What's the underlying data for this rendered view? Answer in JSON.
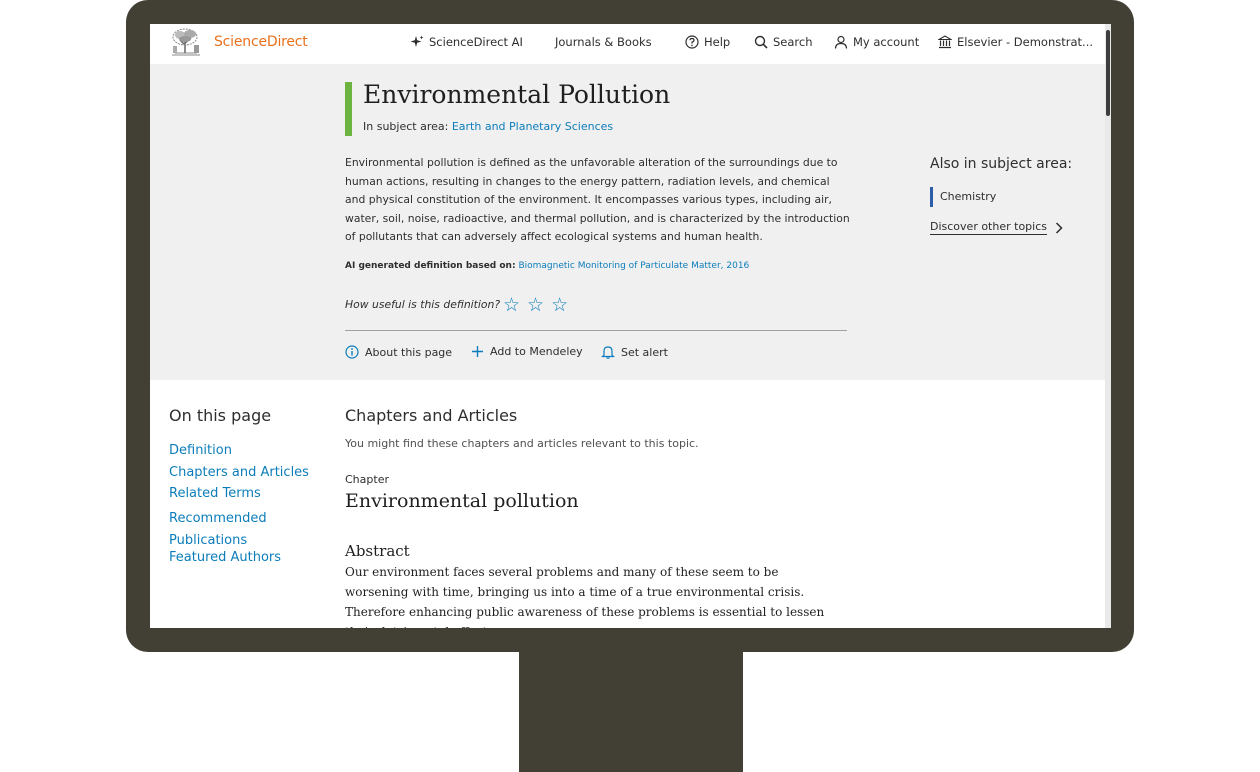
{
  "header": {
    "logo_text": "ScienceDirect",
    "nav": [
      {
        "label": "ScienceDirect AI",
        "icon": "sparkle-icon"
      },
      {
        "label": "Journals & Books",
        "icon": ""
      },
      {
        "label": "Help",
        "icon": "help-circle-icon"
      },
      {
        "label": "Search",
        "icon": "search-icon"
      },
      {
        "label": "My account",
        "icon": "user-icon"
      },
      {
        "label": "Elsevier - Demonstrat...",
        "icon": "institution-icon"
      }
    ]
  },
  "topic": {
    "title": "Environmental Pollution",
    "subject_prefix": "In subject area:",
    "subject_link": "Earth and Planetary Sciences",
    "definition": "Environmental pollution is defined as the unfavorable alteration of the surroundings due to human actions, resulting in changes to the energy pattern, radiation levels, and chemical and physical constitution of the environment. It encompasses various types, including air, water, soil, noise, radioactive, and thermal pollution, and is characterized by the introduction of pollutants that can adversely affect ecological systems and human health.",
    "ai_label": "AI generated definition based on:",
    "ai_source": "Biomagnetic Monitoring of Particulate Matter, 2016",
    "rating_prompt": "How useful is this definition?",
    "rating_max": 3,
    "rating_value": 0,
    "actions": [
      {
        "label": "About this page",
        "icon": "info-icon"
      },
      {
        "label": "Add to Mendeley",
        "icon": "plus-icon"
      },
      {
        "label": "Set alert",
        "icon": "bell-icon"
      }
    ]
  },
  "also_in": {
    "title": "Also in subject area:",
    "items": [
      "Chemistry"
    ],
    "discover": "Discover other topics"
  },
  "toc": {
    "title": "On this page",
    "items": [
      "Definition",
      "Chapters and Articles",
      "Related Terms",
      "Recommended Publications",
      "Featured Authors"
    ]
  },
  "chapters": {
    "title": "Chapters and Articles",
    "subtitle": "You might find these chapters and articles relevant to this topic.",
    "first": {
      "label": "Chapter",
      "title": "Environmental pollution",
      "abstract_heading": "Abstract",
      "abstract_text": "Our environment faces several problems and many of these seem to be worsening with time, bringing us into a time of a true environmental crisis. Therefore enhancing public awareness of these problems is essential to lessen their detrimental effects."
    }
  },
  "colors": {
    "frame": "#423f35",
    "accent_green": "#6cb33f",
    "link_blue": "#0c7dbb",
    "brand_orange": "#e9711c",
    "subject_bar": "#2b5da8"
  }
}
